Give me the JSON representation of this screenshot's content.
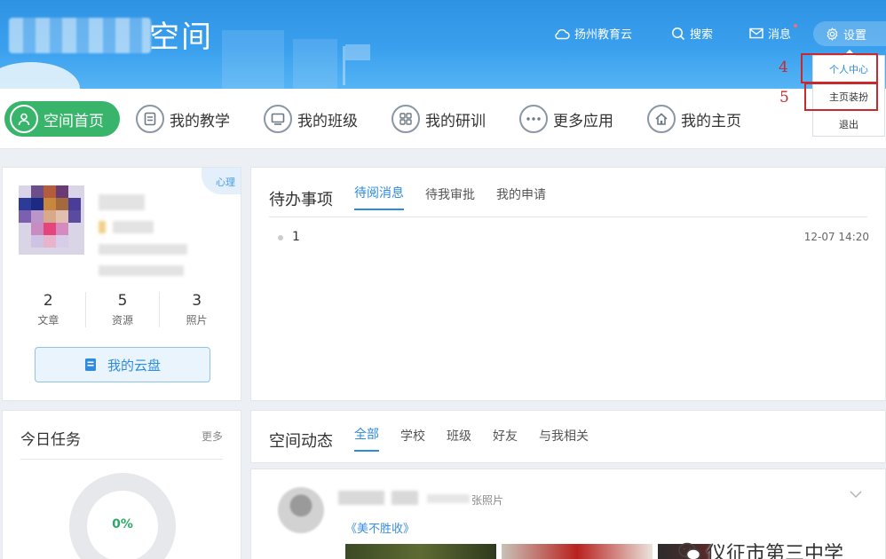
{
  "header": {
    "title_suffix": "空间",
    "links": {
      "cloud": "扬州教育云",
      "search": "搜索",
      "messages": "消息",
      "settings": "设置"
    }
  },
  "dropdown": {
    "items": [
      "个人中心",
      "主页装扮",
      "退出"
    ],
    "annotations": [
      "4",
      "5"
    ]
  },
  "nav": {
    "items": [
      "空间首页",
      "我的教学",
      "我的班级",
      "我的研训",
      "更多应用",
      "我的主页"
    ]
  },
  "profile": {
    "tag": "心理",
    "stats": [
      {
        "value": "2",
        "label": "文章"
      },
      {
        "value": "5",
        "label": "资源"
      },
      {
        "value": "3",
        "label": "照片"
      }
    ],
    "cloud_button": "我的云盘"
  },
  "todo": {
    "title": "待办事项",
    "tabs": [
      "待阅消息",
      "待我审批",
      "我的申请"
    ],
    "items": [
      {
        "text": "1",
        "time": "12-07 14:20"
      }
    ]
  },
  "tasks": {
    "title": "今日任务",
    "more": "更多",
    "progress": "0%"
  },
  "feed": {
    "title": "空间动态",
    "tabs": [
      "全部",
      "学校",
      "班级",
      "好友",
      "与我相关"
    ],
    "photo_label": "张照片",
    "link": "《美不胜收》"
  },
  "watermark": "仪征市第三中学",
  "colors": {
    "primary": "#2d8be0",
    "green": "#38b56b",
    "annotation": "#c9282d"
  }
}
